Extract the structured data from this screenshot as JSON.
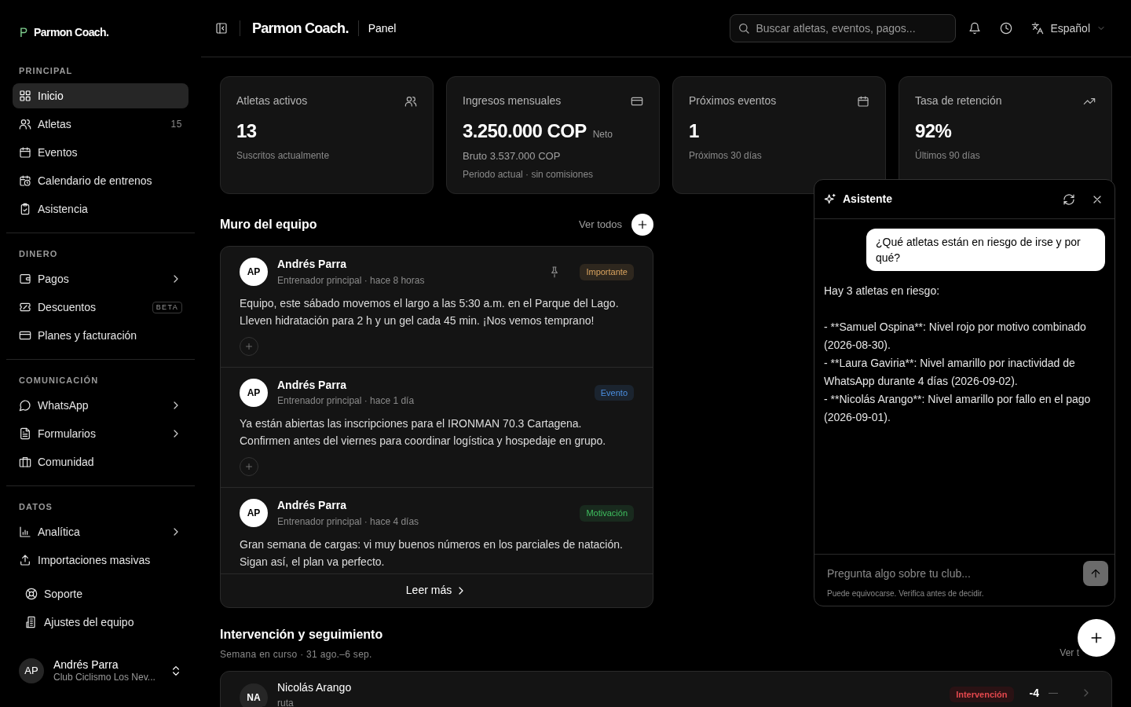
{
  "sidebar": {
    "brand": "Parmon Coach.",
    "sections": [
      {
        "title": "PRINCIPAL",
        "items": [
          {
            "label": "Inicio",
            "selected": true
          },
          {
            "label": "Atletas",
            "selected": false,
            "count": "15"
          },
          {
            "label": "Eventos",
            "selected": false
          },
          {
            "label": "Calendario de entrenos",
            "selected": false
          },
          {
            "label": "Asistencia",
            "selected": false
          }
        ]
      },
      {
        "title": "DINERO",
        "items": [
          {
            "label": "Pagos",
            "selected": false,
            "expandable": true
          },
          {
            "label": "Descuentos",
            "selected": false,
            "badge": "BETA"
          },
          {
            "label": "Planes y facturación",
            "selected": false
          }
        ]
      },
      {
        "title": "COMUNICACIÓN",
        "items": [
          {
            "label": "WhatsApp",
            "selected": false,
            "expandable": true
          },
          {
            "label": "Formularios",
            "selected": false,
            "expandable": true
          },
          {
            "label": "Comunidad",
            "selected": false
          }
        ]
      },
      {
        "title": "DATOS",
        "items": [
          {
            "label": "Analítica",
            "selected": false,
            "expandable": true
          },
          {
            "label": "Importaciones masivas",
            "selected": false
          }
        ]
      }
    ],
    "footer_items": [
      "Soporte",
      "Ajustes del equipo"
    ],
    "user": {
      "initials": "AP",
      "name": "Andrés Parra",
      "club": "Club Ciclismo Los Nev..."
    }
  },
  "header": {
    "brand": "Parmon Coach.",
    "page": "Panel",
    "search": {
      "placeholder": "Buscar atletas, eventos, pagos..."
    },
    "language": "Español"
  },
  "stats": [
    {
      "title": "Atletas activos",
      "value": "13",
      "lines": [
        "Suscritos actualmente"
      ]
    },
    {
      "title": "Ingresos mensuales",
      "value": "3.250.000 COP",
      "suffix": "Neto",
      "lines": [
        "Bruto 3.537.000 COP",
        "Periodo actual · sin comisiones"
      ]
    },
    {
      "title": "Próximos eventos",
      "value": "1",
      "lines": [
        "Próximos 30 días"
      ]
    },
    {
      "title": "Tasa de retención",
      "value": "92%",
      "lines": [
        "Últimos 90 días"
      ]
    }
  ],
  "wall": {
    "title": "Muro del equipo",
    "link": "Ver todos",
    "read_more": "Leer más",
    "posts": [
      {
        "initials": "AP",
        "author": "Andrés Parra",
        "meta": "Entrenador principal · hace 8 horas",
        "pinned": true,
        "tag": "Importante",
        "color": "#d9a35f",
        "body": "Equipo, este sábado movemos el largo a las 5:30 a.m. en el Parque del Lago. Lleven hidratación para 2 h y un gel cada 45 min. ¡Nos vemos temprano!",
        "reactions": true
      },
      {
        "initials": "AP",
        "author": "Andrés Parra",
        "meta": "Entrenador principal · hace 1 día",
        "pinned": false,
        "tag": "Evento",
        "color": "#4b8fe2",
        "body": "Ya están abiertas las inscripciones para el IRONMAN 70.3 Cartagena. Confirmen antes del viernes para coordinar logística y hospedaje en grupo.",
        "reactions": true
      },
      {
        "initials": "AP",
        "author": "Andrés Parra",
        "meta": "Entrenador principal · hace 4 días",
        "pinned": false,
        "tag": "Motivación",
        "color": "#3fbf5f",
        "body": "Gran semana de cargas: vi muy buenos números en los parciales de natación. Sigan así, el plan va perfecto.",
        "reactions": false
      }
    ]
  },
  "intervention": {
    "title": "Intervención y seguimiento",
    "subtitle": "Semana en curso · 31 ago.–6 sep.",
    "link": "Ver t",
    "rows": [
      {
        "initials": "NA",
        "name": "Nicolás Arango",
        "detail": "ruta",
        "alert": true,
        "status": "Intervención",
        "color": "#e5484d",
        "score": "-4",
        "trend": "—"
      }
    ]
  },
  "assistant": {
    "title": "Asistente",
    "messages": [
      {
        "kind": "user",
        "text": "¿Qué atletas están en riesgo de irse y por qué?"
      },
      {
        "kind": "assistant",
        "text": "Hay 3 atletas en riesgo:\n\n- **Samuel Ospina**: Nivel rojo por motivo combinado (2026-08-30).\n- **Laura Gaviria**: Nivel amarillo por inactividad de WhatsApp durante 4 días (2026-09-02).\n- **Nicolás Arango**: Nivel amarillo por fallo en el pago (2026-09-01)."
      }
    ],
    "input": {
      "placeholder": "Pregunta algo sobre tu club..."
    },
    "disclaimer": "Puede equivocarse. Verifica antes de decidir."
  }
}
